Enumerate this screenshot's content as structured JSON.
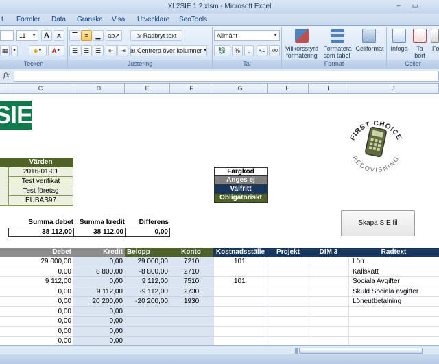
{
  "window": {
    "title": "XL2SIE 1.2.xlsm  -  Microsoft Excel",
    "min_label": "–",
    "max_label": "▭"
  },
  "tabs": [
    "t",
    "Formler",
    "Data",
    "Granska",
    "Visa",
    "Utvecklare",
    "SeoTools"
  ],
  "ribbon": {
    "font_size": "11",
    "grow_font": "A",
    "shrink_font": "A",
    "wrap_text": "Radbryt text",
    "merge_center": "Centrera över kolumner",
    "number_format": "Allmänt",
    "percent": "%",
    "thousands": ",",
    "conditional": "Villkorsstyrd formatering",
    "format_table": "Formatera som tabell",
    "cell_styles": "Cellformat",
    "insert": "Infoga",
    "delete": "Ta bort",
    "format_short": "Fo",
    "groups": {
      "font": "Tecken",
      "alignment": "Justering",
      "number": "Tal",
      "styles": "Format",
      "cells": "Celler"
    }
  },
  "formula_bar": {
    "fx": "fx"
  },
  "columns": [
    "",
    "C",
    "D",
    "E",
    "F",
    "G",
    "H",
    "I",
    "J"
  ],
  "logo": {
    "text": "SIE"
  },
  "stamp": {
    "top": "FIRST CHOICE",
    "bottom": "REDOVISNING"
  },
  "values": {
    "header": "Värden",
    "items": [
      "2016-01-01",
      "Test verifikat",
      "Test företag",
      "EUBAS97"
    ]
  },
  "legend": {
    "title": "Färgkod",
    "items": [
      {
        "label": "Anges ej",
        "bg": "#808080",
        "color": "#ffffff"
      },
      {
        "label": "Valfritt",
        "bg": "#17375e",
        "color": "#ffffff"
      },
      {
        "label": "Obligatoriskt",
        "bg": "#4f6228",
        "color": "#ffffff"
      }
    ]
  },
  "sums": {
    "debet_label": "Summa debet",
    "kredit_label": "Summa kredit",
    "diff_label": "Differens",
    "debet": "38 112,00",
    "kredit": "38 112,00",
    "diff": "0,00"
  },
  "button": {
    "label": "Skapa SIE fil"
  },
  "table": {
    "headers": {
      "debet": "Debet",
      "kredit": "Kredit",
      "belopp": "Belopp",
      "konto": "Konto",
      "kostnad": "Kostnadsställe",
      "projekt": "Projekt",
      "dim3": "DIM 3",
      "radtext": "Radtext"
    },
    "rows": [
      {
        "debet": "29 000,00",
        "kredit": "0,00",
        "belopp": "29 000,00",
        "konto": "7210",
        "kostnad": "101",
        "radtext": "Lön"
      },
      {
        "debet": "0,00",
        "kredit": "8 800,00",
        "belopp": "-8 800,00",
        "konto": "2710",
        "kostnad": "",
        "radtext": "Källskatt"
      },
      {
        "debet": "9 112,00",
        "kredit": "0,00",
        "belopp": "9 112,00",
        "konto": "7510",
        "kostnad": "101",
        "radtext": "Sociala Avgifter"
      },
      {
        "debet": "0,00",
        "kredit": "9 112,00",
        "belopp": "-9 112,00",
        "konto": "2730",
        "kostnad": "",
        "radtext": "Skuld Sociala avgifter"
      },
      {
        "debet": "0,00",
        "kredit": "20 200,00",
        "belopp": "-20 200,00",
        "konto": "1930",
        "kostnad": "",
        "radtext": "Löneutbetalning"
      },
      {
        "debet": "0,00",
        "kredit": "0,00",
        "belopp": "",
        "konto": "",
        "kostnad": "",
        "radtext": ""
      },
      {
        "debet": "0,00",
        "kredit": "0,00",
        "belopp": "",
        "konto": "",
        "kostnad": "",
        "radtext": ""
      },
      {
        "debet": "0,00",
        "kredit": "0,00",
        "belopp": "",
        "konto": "",
        "kostnad": "",
        "radtext": ""
      },
      {
        "debet": "0,00",
        "kredit": "0,00",
        "belopp": "",
        "konto": "",
        "kostnad": "",
        "radtext": ""
      }
    ]
  },
  "colors": {
    "grey_header": "#8c8c8c",
    "green_header": "#4f6228",
    "navy_header": "#17375e",
    "selected_cell_fill": "#dbe5f1"
  }
}
